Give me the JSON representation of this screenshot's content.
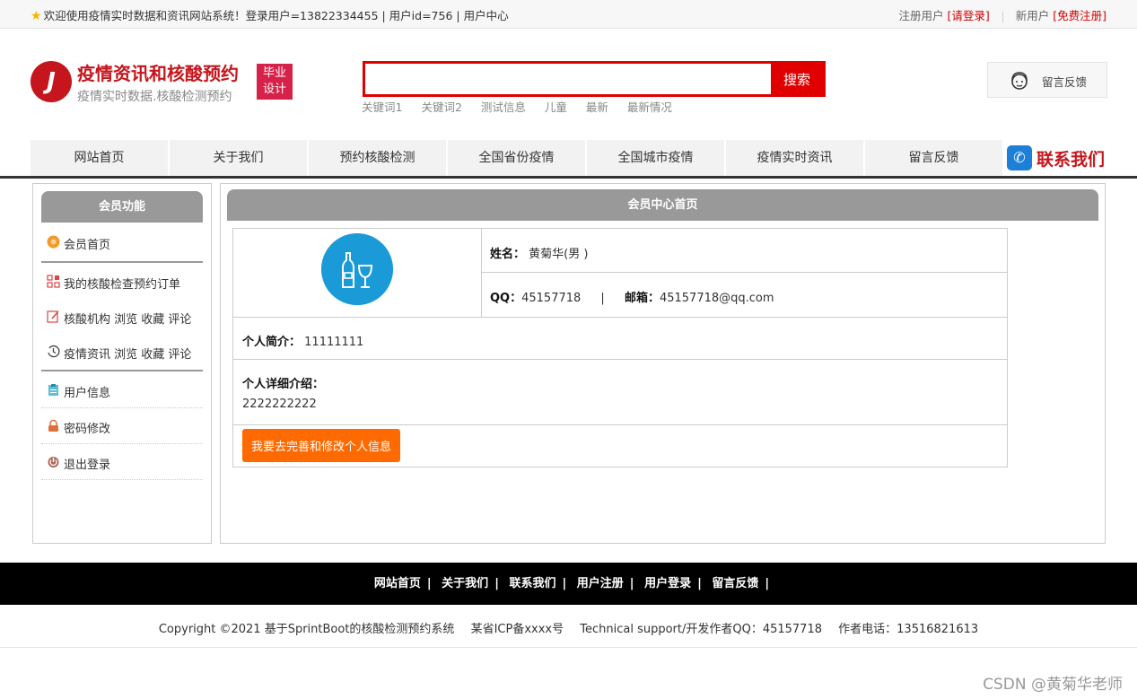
{
  "topbar": {
    "welcome": "欢迎使用疫情实时数据和资讯网站系统！登录用户=13822334455 | 用户id=756 | 用户中心",
    "register_user": "注册用户",
    "login_link": "[请登录]",
    "new_user": "新用户",
    "free_register": "[免费注册]"
  },
  "header": {
    "logo_title": "疫情资讯和核酸预约",
    "logo_subtitle": "疫情实时数据.核酸检测预约",
    "badge_line1": "毕业",
    "badge_line2": "设计",
    "search_button": "搜索",
    "search_value": "",
    "keywords": [
      "关键词1",
      "关键词2",
      "测试信息",
      "儿童",
      "最新",
      "最新情况"
    ],
    "feedback": "留言反馈"
  },
  "nav": {
    "items": [
      "网站首页",
      "关于我们",
      "预约核酸检测",
      "全国省份疫情",
      "全国城市疫情",
      "疫情实时资讯",
      "留言反馈"
    ],
    "contact": "联系我们"
  },
  "sidebar": {
    "title": "会员功能",
    "items": [
      "会员首页",
      "我的核酸检查预约订单",
      "核酸机构 浏览 收藏 评论",
      "疫情资讯 浏览 收藏 评论",
      "用户信息",
      "密码修改",
      "退出登录"
    ]
  },
  "main": {
    "title": "会员中心首页",
    "name_label": "姓名：",
    "name_value": "黄菊华(男 )",
    "qq_label": "QQ：",
    "qq_value": "45157718",
    "sep": "|",
    "email_label": "邮箱：",
    "email_value": "45157718@qq.com",
    "intro_label": "个人简介：",
    "intro_value": "11111111",
    "detail_label": "个人详细介绍：",
    "detail_value": "2222222222",
    "edit_button": "我要去完善和修改个人信息"
  },
  "footer": {
    "links": [
      "网站首页",
      "关于我们",
      "联系我们",
      "用户注册",
      "用户登录",
      "留言反馈"
    ],
    "copyright": "Copyright ©2021 基于SprintBoot的核酸检测预约系统",
    "icp": "某省ICP备xxxx号",
    "support": "Technical support/开发作者QQ：45157718",
    "phone": "作者电话：13516821613"
  },
  "watermark": "CSDN @黄菊华老师",
  "colors": {
    "brand_red": "#c4161c",
    "search_red": "#e00000",
    "button_orange": "#ff6a00",
    "avatar_blue": "#1a9ad6",
    "panel_gray": "#999999"
  }
}
